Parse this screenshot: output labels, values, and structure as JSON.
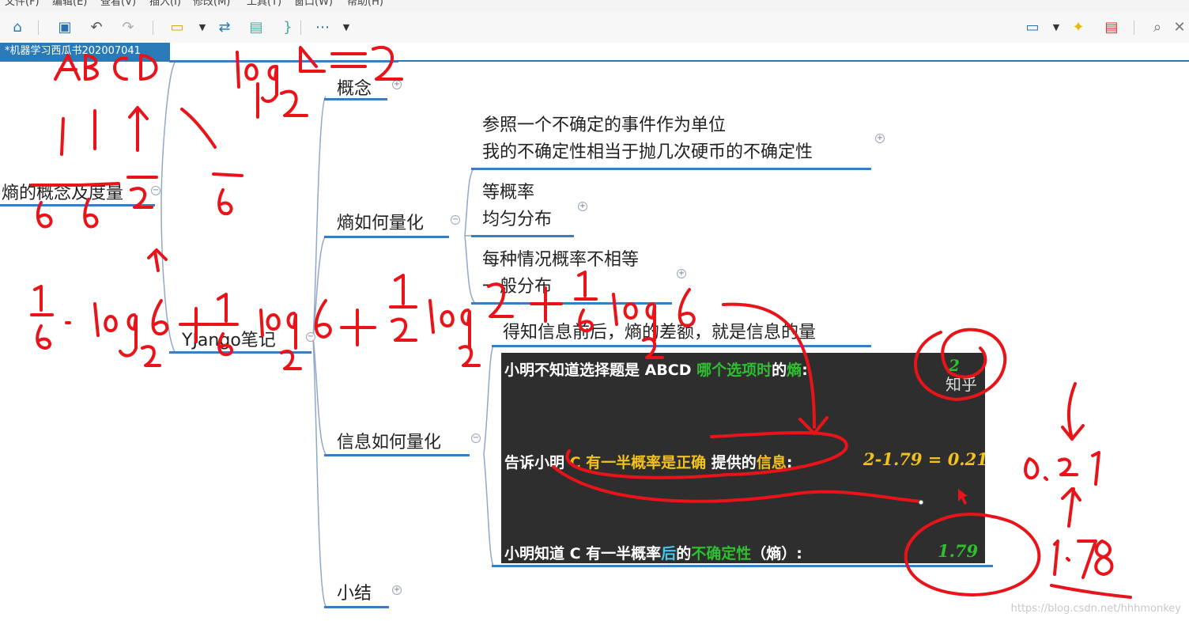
{
  "menu": [
    "文件(F)",
    "编辑(E)",
    "查看(V)",
    "插入(I)",
    "修改(M)",
    "工具(T)",
    "窗口(W)",
    "帮助(H)"
  ],
  "tab": {
    "title": "*机器学习西瓜书202007041"
  },
  "mindmap": {
    "root": "熵的概念及度量",
    "branch": "YJango笔记",
    "children": {
      "concept": "概念",
      "quantify_entropy": "熵如何量化",
      "quantify_info": "信息如何量化",
      "summary": "小结"
    },
    "entropy_items": [
      {
        "line1": "参照一个不确定的事件作为单位",
        "line2": "我的不确定性相当于抛几次硬币的不确定性"
      },
      {
        "line1": "等概率",
        "line2": "均匀分布"
      },
      {
        "line1": "每种情况概率不相等",
        "line2": "一般分布"
      }
    ],
    "info_note": "得知信息前后，熵的差额，就是信息的量"
  },
  "panel": {
    "row1": {
      "prefix": "小明不知道选择题是 ABCD ",
      "highlight": "哪个选项时",
      "mid": "的",
      "tail": "熵",
      "colon": ":",
      "value": "2"
    },
    "row2": {
      "prefix": "告诉小明 ",
      "highlight": "C 有一半概率是正确",
      "mid": " 提供的",
      "tail": "信息",
      "colon": ":",
      "value": "2-1.79 = 0.21"
    },
    "row3": {
      "prefix": "小明知道 C 有一半概率",
      "highlight": "后",
      "mid": "的",
      "tail": "不确定性",
      "paren": "（熵）:",
      "value": "1.79"
    },
    "zhihu": "知乎"
  },
  "annotations": {
    "top_formula": "ABCD: log₂4=2",
    "probs": [
      "1/6",
      "1/6",
      "1/2",
      "1/6"
    ],
    "long_formula": "1/6·log₂6 + 1/6 log₂6 + 1/2 log₂2 + 1/6 log₂6",
    "side_values": [
      "0.21",
      "1.78"
    ]
  },
  "colors": {
    "accent": "#2a7ab8",
    "ink": "#e8141a",
    "highlight_green": "#2fbf2f",
    "highlight_yellow": "#f2c21a"
  },
  "watermark": "https://blog.csdn.net/hhhmonkey"
}
